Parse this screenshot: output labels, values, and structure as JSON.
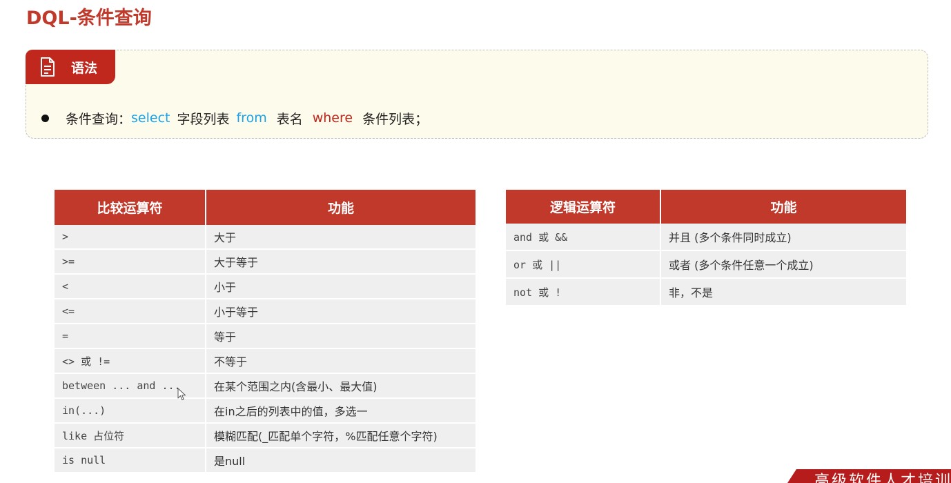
{
  "page": {
    "title": "DQL-条件查询"
  },
  "syntax": {
    "tag_label": "语法",
    "prefix": "条件查询：",
    "kw_select": "select",
    "fields": "字段列表",
    "kw_from": "from",
    "table_name": "表名",
    "kw_where": "where",
    "conditions": "条件列表；"
  },
  "comparison_table": {
    "headers": [
      "比较运算符",
      "功能"
    ],
    "rows": [
      [
        ">",
        "大于"
      ],
      [
        ">=",
        "大于等于"
      ],
      [
        "<",
        "小于"
      ],
      [
        "<=",
        "小于等于"
      ],
      [
        "=",
        "等于"
      ],
      [
        "<> 或 !=",
        "不等于"
      ],
      [
        "between ... and ...",
        "在某个范围之内(含最小、最大值)"
      ],
      [
        "in(...)",
        "在in之后的列表中的值，多选一"
      ],
      [
        "like 占位符",
        "模糊匹配(_匹配单个字符，%匹配任意个字符)"
      ],
      [
        "is null",
        "是null"
      ]
    ]
  },
  "logic_table": {
    "headers": [
      "逻辑运算符",
      "功能"
    ],
    "rows": [
      [
        "and 或 &&",
        "并且 (多个条件同时成立)"
      ],
      [
        "or 或 ||",
        "或者 (多个条件任意一个成立)"
      ],
      [
        "not 或 !",
        "非，不是"
      ]
    ]
  },
  "brand": {
    "text": "高级软件人才培训"
  },
  "colors": {
    "accent": "#c0392b",
    "keyword_blue": "#1aa3e8",
    "box_bg": "#fdfbeb"
  },
  "icons": {
    "syntax_tag": "document-icon",
    "pointer": "mouse-cursor-icon"
  }
}
